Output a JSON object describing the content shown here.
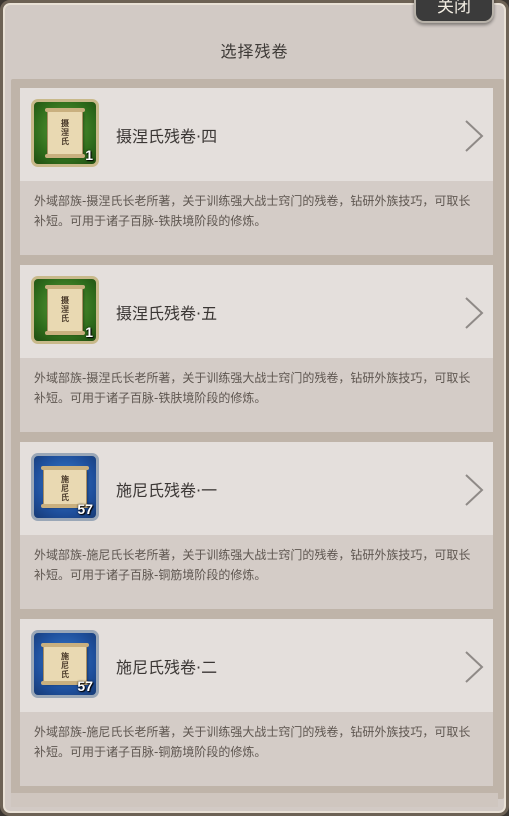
{
  "dialog": {
    "title": "选择残卷",
    "close_label": "关闭"
  },
  "items": [
    {
      "name": "摄涅氏残卷·四",
      "count": "1",
      "rarity_color": "green",
      "icon": "scroll-icon",
      "description": "外域部族-摄涅氏长老所著，关于训练强大战士窍门的残卷，钻研外族技巧，可取长补短。可用于诸子百脉-铁肤境阶段的修炼。"
    },
    {
      "name": "摄涅氏残卷·五",
      "count": "1",
      "rarity_color": "green",
      "icon": "scroll-icon",
      "description": "外域部族-摄涅氏长老所著，关于训练强大战士窍门的残卷，钻研外族技巧，可取长补短。可用于诸子百脉-铁肤境阶段的修炼。"
    },
    {
      "name": "施尼氏残卷·一",
      "count": "57",
      "rarity_color": "blue",
      "icon": "scroll-icon",
      "description": "外域部族-施尼氏长老所著，关于训练强大战士窍门的残卷，钻研外族技巧，可取长补短。可用于诸子百脉-铜筋境阶段的修炼。"
    },
    {
      "name": "施尼氏残卷·二",
      "count": "57",
      "rarity_color": "blue",
      "icon": "scroll-icon",
      "description": "外域部族-施尼氏长老所著，关于训练强大战士窍门的残卷，钻研外族技巧，可取长补短。可用于诸子百脉-铜筋境阶段的修炼。"
    }
  ]
}
